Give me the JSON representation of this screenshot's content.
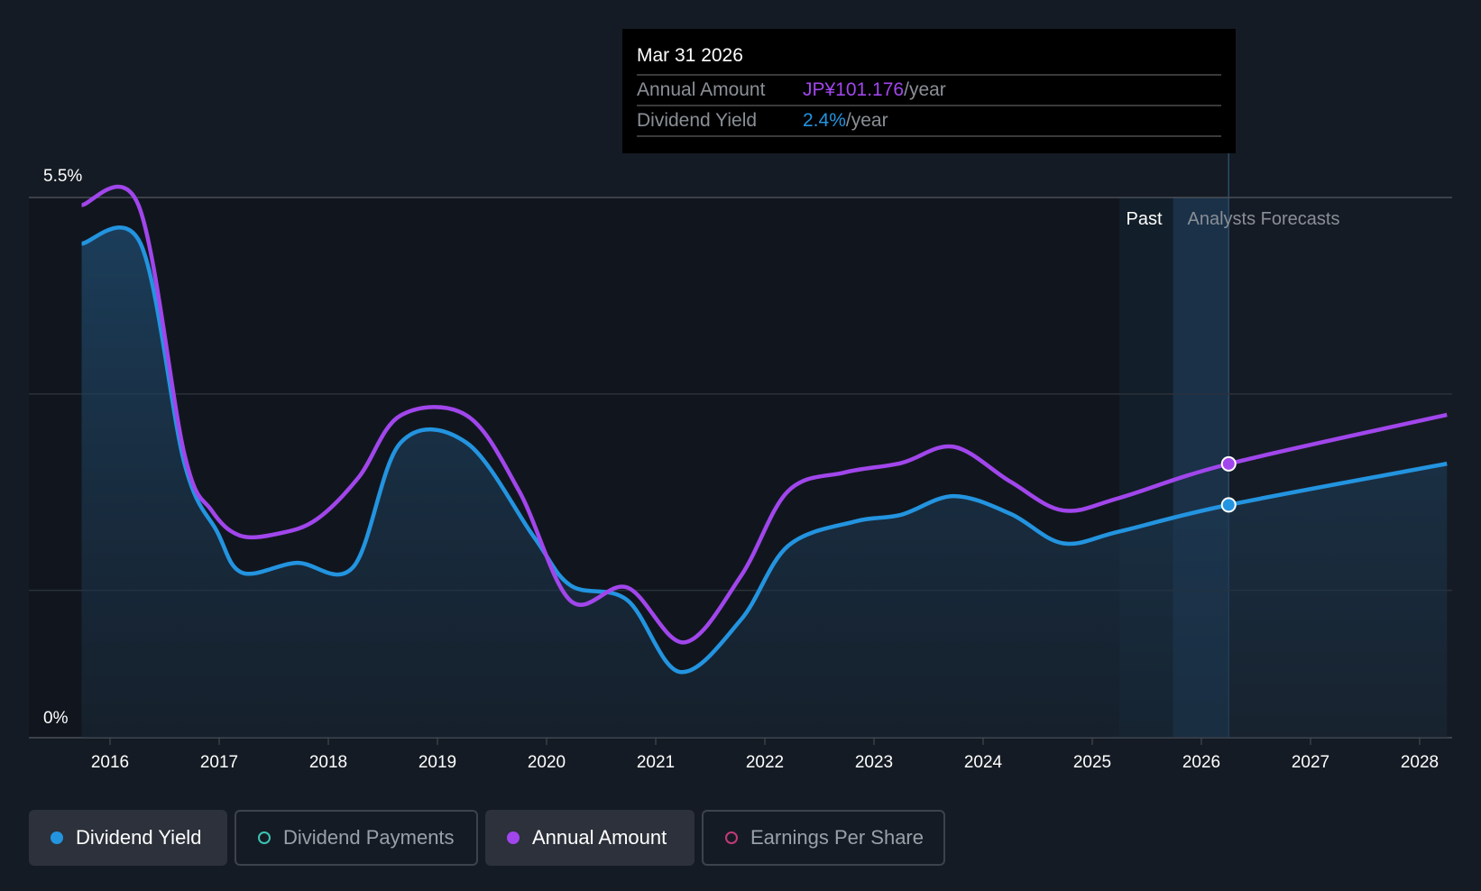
{
  "chart_data": {
    "type": "line",
    "y_axis": {
      "labels": [
        "5.5%",
        "0%"
      ],
      "range": [
        0,
        5.5
      ],
      "unit": "%"
    },
    "amount_axis_range_jpy": [
      0,
      199.6
    ],
    "x_ticks": [
      "2016",
      "2017",
      "2018",
      "2019",
      "2020",
      "2021",
      "2022",
      "2023",
      "2024",
      "2025",
      "2026",
      "2027",
      "2028"
    ],
    "x_range": [
      2015.74,
      2028.25
    ],
    "regions": {
      "past_label": "Past",
      "forecast_label": "Analysts Forecasts",
      "past_start": 2025.25,
      "forecast_start": 2025.74,
      "cursor": 2026.25
    },
    "series": [
      {
        "name": "Dividend Yield",
        "color": "#2394e0",
        "unit": "%",
        "points": [
          [
            2015.74,
            5.03
          ],
          [
            2016.28,
            5.03
          ],
          [
            2016.68,
            2.8
          ],
          [
            2016.98,
            2.1
          ],
          [
            2017.21,
            1.68
          ],
          [
            2017.71,
            1.78
          ],
          [
            2018.23,
            1.74
          ],
          [
            2018.66,
            3.0
          ],
          [
            2019.27,
            3.0
          ],
          [
            2019.88,
            2.05
          ],
          [
            2020.22,
            1.55
          ],
          [
            2020.74,
            1.4
          ],
          [
            2021.22,
            0.67
          ],
          [
            2021.78,
            1.2
          ],
          [
            2022.21,
            1.95
          ],
          [
            2022.82,
            2.2
          ],
          [
            2023.25,
            2.27
          ],
          [
            2023.73,
            2.46
          ],
          [
            2024.25,
            2.28
          ],
          [
            2024.73,
            1.98
          ],
          [
            2025.25,
            2.1
          ],
          [
            2026.25,
            2.37
          ],
          [
            2028.25,
            2.79
          ]
        ]
      },
      {
        "name": "Annual Amount",
        "color": "#a146ec",
        "unit": "JPY",
        "points": [
          [
            2015.74,
            196.8
          ],
          [
            2016.26,
            196.8
          ],
          [
            2016.68,
            105
          ],
          [
            2016.93,
            84
          ],
          [
            2017.19,
            74.7
          ],
          [
            2017.54,
            75.4
          ],
          [
            2017.89,
            80.6
          ],
          [
            2018.28,
            96.3
          ],
          [
            2018.66,
            119
          ],
          [
            2019.27,
            119
          ],
          [
            2019.75,
            91
          ],
          [
            2020.22,
            50.6
          ],
          [
            2020.74,
            55.5
          ],
          [
            2021.26,
            35.2
          ],
          [
            2021.78,
            59.7
          ],
          [
            2022.21,
            91
          ],
          [
            2022.73,
            98
          ],
          [
            2023.25,
            101.5
          ],
          [
            2023.73,
            107.5
          ],
          [
            2024.25,
            94.6
          ],
          [
            2024.73,
            84
          ],
          [
            2025.25,
            88.6
          ],
          [
            2026.25,
            101.176
          ],
          [
            2028.25,
            119.3
          ]
        ]
      }
    ]
  },
  "tooltip": {
    "date": "Mar 31 2026",
    "rows": [
      {
        "label": "Annual Amount",
        "value": "JP¥101.176",
        "suffix": "/year",
        "color": "#a146ec"
      },
      {
        "label": "Dividend Yield",
        "value": "2.4%",
        "suffix": "/year",
        "color": "#2394e0"
      }
    ]
  },
  "legend": [
    {
      "label": "Dividend Yield",
      "color": "#2394e0",
      "active": true
    },
    {
      "label": "Dividend Payments",
      "color": "#3cc4b4",
      "active": false
    },
    {
      "label": "Annual Amount",
      "color": "#a146ec",
      "active": true
    },
    {
      "label": "Earnings Per Share",
      "color": "#c23a7a",
      "active": false
    }
  ]
}
